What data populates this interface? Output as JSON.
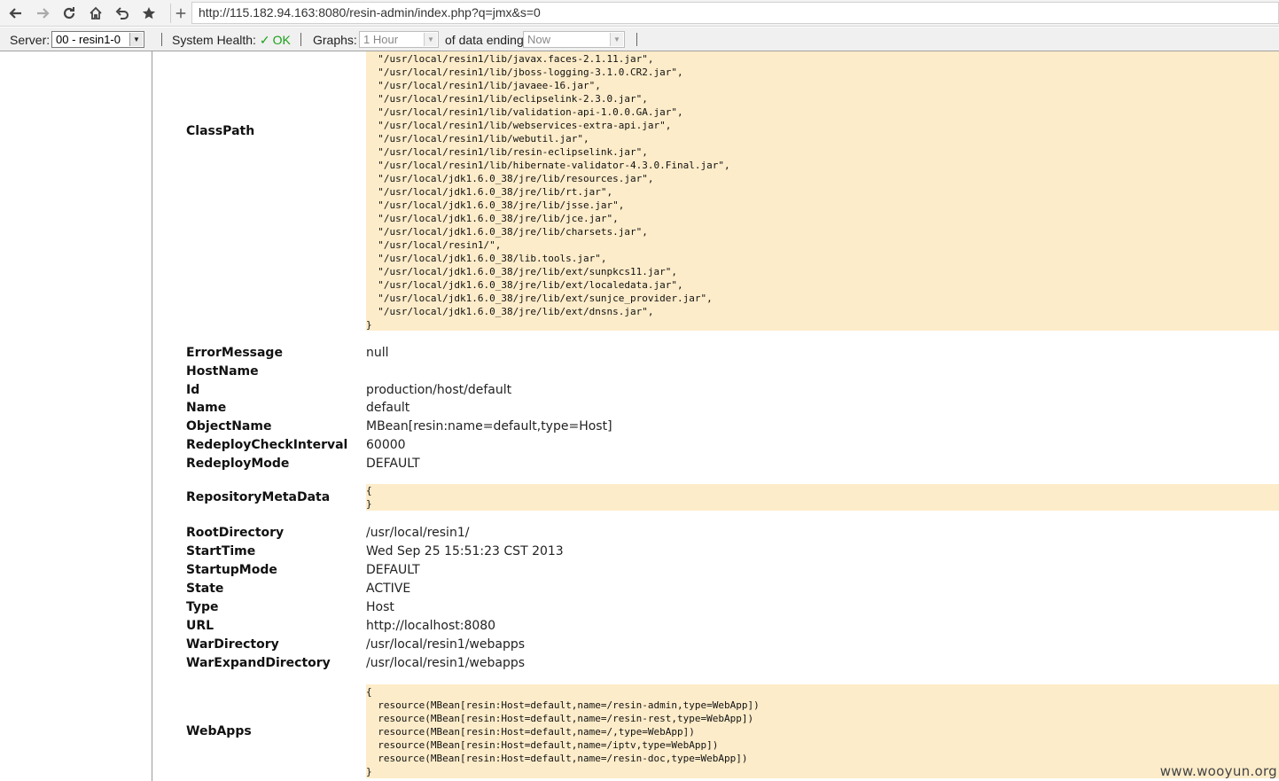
{
  "browser": {
    "url": "http://115.182.94.163:8080/resin-admin/index.php?q=jmx&s=0"
  },
  "admin_bar": {
    "server_label": "Server:",
    "server_value": "00 - resin1-0",
    "health_label": "System Health:",
    "health_check": "✓",
    "health_status": "OK",
    "graphs_label": "Graphs:",
    "graphs_value": "1 Hour",
    "ending_label": "of data ending",
    "ending_value": "Now"
  },
  "classpath": {
    "name": "ClassPath",
    "lines": [
      "  \"/usr/local/resin1/lib/javax.faces-2.1.11.jar\",",
      "  \"/usr/local/resin1/lib/jboss-logging-3.1.0.CR2.jar\",",
      "  \"/usr/local/resin1/lib/javaee-16.jar\",",
      "  \"/usr/local/resin1/lib/eclipselink-2.3.0.jar\",",
      "  \"/usr/local/resin1/lib/validation-api-1.0.0.GA.jar\",",
      "  \"/usr/local/resin1/lib/webservices-extra-api.jar\",",
      "  \"/usr/local/resin1/lib/webutil.jar\",",
      "  \"/usr/local/resin1/lib/resin-eclipselink.jar\",",
      "  \"/usr/local/resin1/lib/hibernate-validator-4.3.0.Final.jar\",",
      "  \"/usr/local/jdk1.6.0_38/jre/lib/resources.jar\",",
      "  \"/usr/local/jdk1.6.0_38/jre/lib/rt.jar\",",
      "  \"/usr/local/jdk1.6.0_38/jre/lib/jsse.jar\",",
      "  \"/usr/local/jdk1.6.0_38/jre/lib/jce.jar\",",
      "  \"/usr/local/jdk1.6.0_38/jre/lib/charsets.jar\",",
      "  \"/usr/local/resin1/\",",
      "  \"/usr/local/jdk1.6.0_38/lib.tools.jar\",",
      "  \"/usr/local/jdk1.6.0_38/jre/lib/ext/sunpkcs11.jar\",",
      "  \"/usr/local/jdk1.6.0_38/jre/lib/ext/localedata.jar\",",
      "  \"/usr/local/jdk1.6.0_38/jre/lib/ext/sunjce_provider.jar\",",
      "  \"/usr/local/jdk1.6.0_38/jre/lib/ext/dnsns.jar\",",
      "}"
    ]
  },
  "props_a": [
    {
      "name": "ErrorMessage",
      "value": "null"
    },
    {
      "name": "HostName",
      "value": ""
    },
    {
      "name": "Id",
      "value": "production/host/default"
    },
    {
      "name": "Name",
      "value": "default"
    },
    {
      "name": "ObjectName",
      "value": "MBean[resin:name=default,type=Host]"
    },
    {
      "name": "RedeployCheckInterval",
      "value": "60000"
    },
    {
      "name": "RedeployMode",
      "value": "DEFAULT"
    }
  ],
  "repository": {
    "name": "RepositoryMetaData",
    "lines": [
      "{",
      "}"
    ]
  },
  "props_b": [
    {
      "name": "RootDirectory",
      "value": "/usr/local/resin1/"
    },
    {
      "name": "StartTime",
      "value": "Wed Sep 25 15:51:23 CST 2013"
    },
    {
      "name": "StartupMode",
      "value": "DEFAULT"
    },
    {
      "name": "State",
      "value": "ACTIVE"
    },
    {
      "name": "Type",
      "value": "Host"
    },
    {
      "name": "URL",
      "value": "http://localhost:8080"
    },
    {
      "name": "WarDirectory",
      "value": "/usr/local/resin1/webapps"
    },
    {
      "name": "WarExpandDirectory",
      "value": "/usr/local/resin1/webapps"
    }
  ],
  "webapps": {
    "name": "WebApps",
    "lines": [
      "{",
      "  resource(MBean[resin:Host=default,name=/resin-admin,type=WebApp])",
      "  resource(MBean[resin:Host=default,name=/resin-rest,type=WebApp])",
      "  resource(MBean[resin:Host=default,name=/,type=WebApp])",
      "  resource(MBean[resin:Host=default,name=/iptv,type=WebApp])",
      "  resource(MBean[resin:Host=default,name=/resin-doc,type=WebApp])",
      "}"
    ]
  },
  "watermark": "www.wooyun.org"
}
